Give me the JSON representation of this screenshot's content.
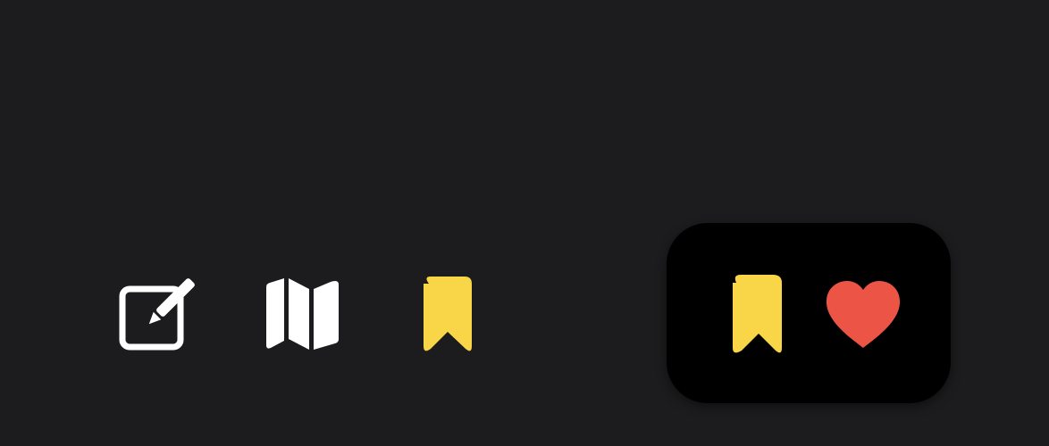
{
  "toolbar": {
    "icons": [
      {
        "name": "compose-icon",
        "color": "#ffffff"
      },
      {
        "name": "map-icon",
        "color": "#ffffff"
      },
      {
        "name": "bookmark-icon",
        "color": "#f9d648"
      }
    ]
  },
  "popup": {
    "icons": [
      {
        "name": "bookmark-icon",
        "color": "#f9d648"
      },
      {
        "name": "heart-icon",
        "color": "#ec5446"
      }
    ],
    "background": "#000000"
  },
  "theme": {
    "background": "#1c1c1e"
  }
}
